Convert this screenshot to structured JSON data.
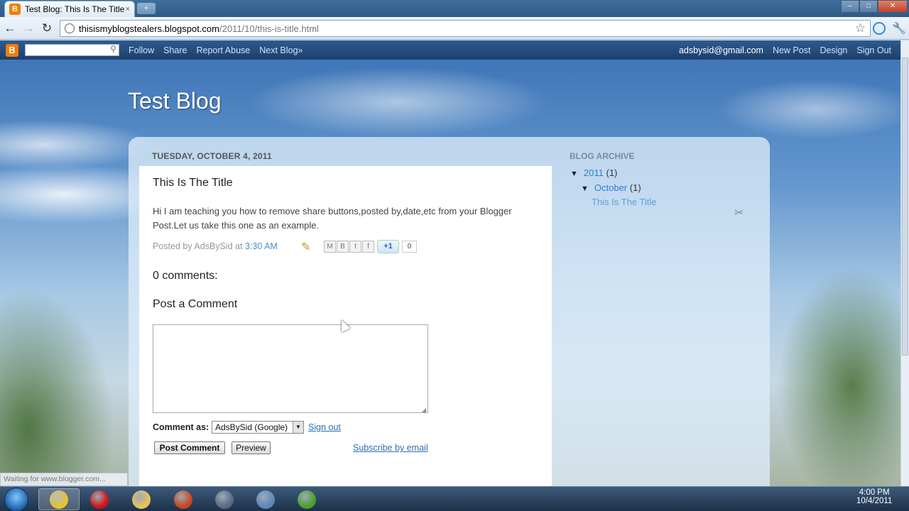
{
  "browser": {
    "tab_title": "Test Blog: This Is The Title",
    "tab_close": "×",
    "new_tab": "+",
    "url_host": "thisismyblogstealers.blogspot.com",
    "url_path": "/2011/10/this-is-title.html",
    "back_glyph": "←",
    "forward_glyph": "→",
    "reload_glyph": "↻",
    "star_glyph": "☆",
    "wrench_glyph": "🔧",
    "window_controls": {
      "minimize": "–",
      "maximize": "□",
      "close": "✕"
    },
    "status_text": "Waiting for www.blogger.com..."
  },
  "navbar": {
    "logo_letter": "B",
    "search_glyph": "⚲",
    "links": [
      "Follow",
      "Share",
      "Report Abuse",
      "Next Blog»"
    ],
    "email": "adsbysid@gmail.com",
    "right_links": [
      "New Post",
      "Design",
      "Sign Out"
    ]
  },
  "blog": {
    "title": "Test Blog",
    "date_header": "TUESDAY, OCTOBER 4, 2011",
    "post": {
      "title": "This Is The Title",
      "body": "Hi I am teaching you how to remove share buttons,posted by,date,etc from your Blogger Post.Let us take this one as an example.",
      "posted_by_prefix": "Posted by AdsBySid at",
      "time": "3:30 AM",
      "share_buttons": [
        "M",
        "B",
        "t",
        "f"
      ],
      "plusone_label": "+1",
      "plusone_count": "0"
    },
    "comments": {
      "count_label": "0 comments:",
      "heading": "Post a Comment",
      "comment_as_label": "Comment as:",
      "comment_as_value": "AdsBySid (Google)",
      "dropdown_arrow": "▼",
      "sign_out": "Sign out",
      "post_button": "Post Comment",
      "preview_button": "Preview",
      "subscribe": "Subscribe by email"
    }
  },
  "sidebar": {
    "heading": "BLOG ARCHIVE",
    "year": {
      "triangle": "▼",
      "label": "2011",
      "count": "(1)"
    },
    "month": {
      "triangle": "▼",
      "label": "October",
      "count": "(1)"
    },
    "post_link": "This Is The Title",
    "tools_glyph": "✂"
  },
  "taskbar": {
    "time": "4:00 PM",
    "date": "10/4/2011",
    "apps": [
      {
        "name": "chrome",
        "color": "#e8c12e",
        "active": true
      },
      {
        "name": "opera",
        "color": "#d0141b",
        "active": false
      },
      {
        "name": "explorer",
        "color": "#e7c35a",
        "active": false
      },
      {
        "name": "flash",
        "color": "#c8461d",
        "active": false
      },
      {
        "name": "movie-maker",
        "color": "#5a6a85",
        "active": false
      },
      {
        "name": "webcam",
        "color": "#5d88b8",
        "active": false
      },
      {
        "name": "utorrent",
        "color": "#4aa02c",
        "active": false
      }
    ]
  }
}
